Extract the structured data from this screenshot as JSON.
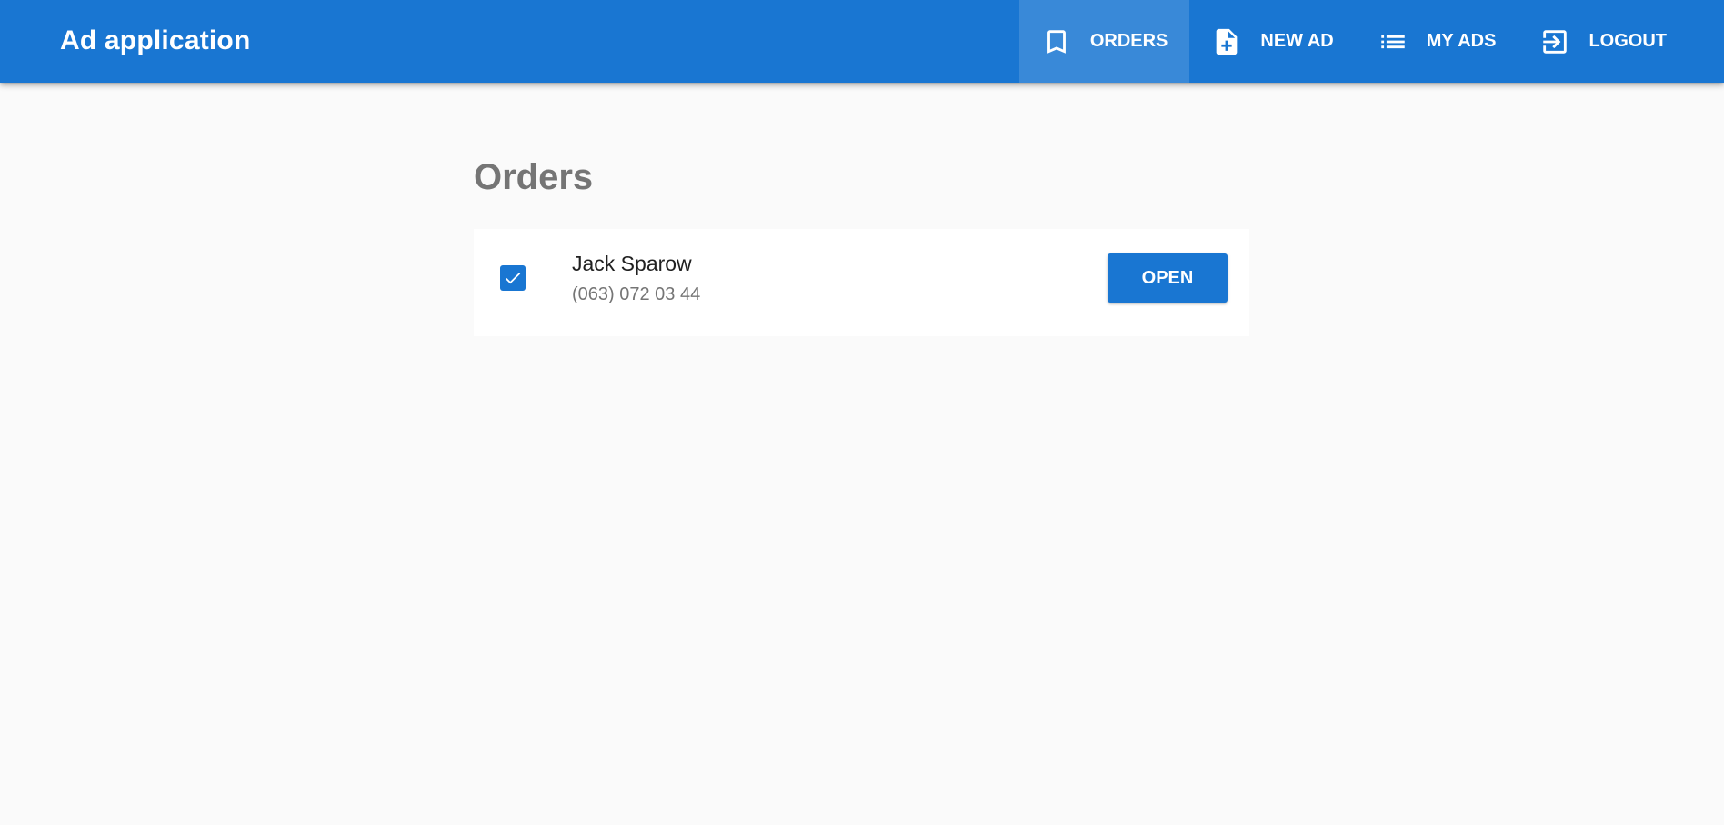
{
  "app": {
    "title": "Ad application"
  },
  "nav": {
    "items": [
      {
        "label": "ORDERS",
        "icon": "bookmark-icon",
        "active": true
      },
      {
        "label": "NEW AD",
        "icon": "note-add-icon",
        "active": false
      },
      {
        "label": "MY ADS",
        "icon": "list-icon",
        "active": false
      },
      {
        "label": "LOGOUT",
        "icon": "exit-to-app-icon",
        "active": false
      }
    ]
  },
  "page": {
    "title": "Orders"
  },
  "orders": [
    {
      "name": "Jack Sparow",
      "phone": "(063) 072 03 44",
      "checked": true,
      "open_label": "OPEN"
    }
  ],
  "colors": {
    "primary": "#1976d2",
    "background": "#fafafa",
    "title_text": "#757575"
  }
}
